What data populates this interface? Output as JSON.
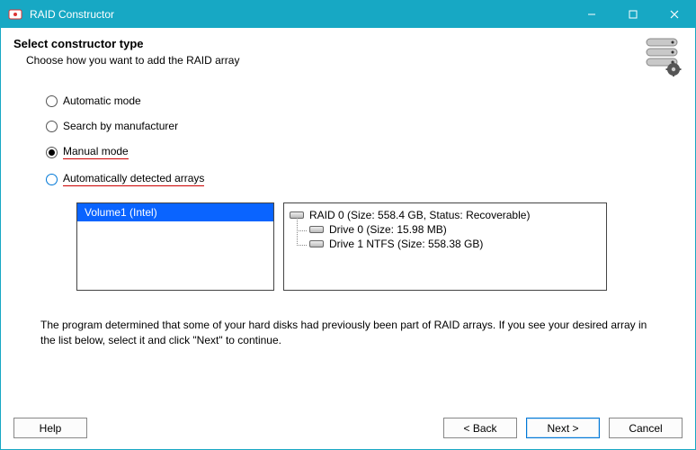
{
  "window": {
    "title": "RAID Constructor"
  },
  "header": {
    "title": "Select constructor type",
    "subtitle": "Choose how you want to add the RAID array"
  },
  "options": {
    "automatic": "Automatic mode",
    "by_manufacturer": "Search by manufacturer",
    "manual": "Manual mode",
    "auto_detected": "Automatically detected arrays"
  },
  "detected": {
    "volume_label": "Volume1 (Intel)",
    "raid_summary": "RAID 0 (Size: 558.4 GB, Status: Recoverable)",
    "drive0": "Drive 0 (Size: 15.98 MB)",
    "drive1": "Drive 1 NTFS (Size: 558.38 GB)"
  },
  "info": "The program determined that some of your hard disks had previously been part of RAID arrays. If you see your desired array in the list below, select it and click \"Next\" to continue.",
  "buttons": {
    "help": "Help",
    "back": "< Back",
    "next": "Next >",
    "cancel": "Cancel"
  }
}
